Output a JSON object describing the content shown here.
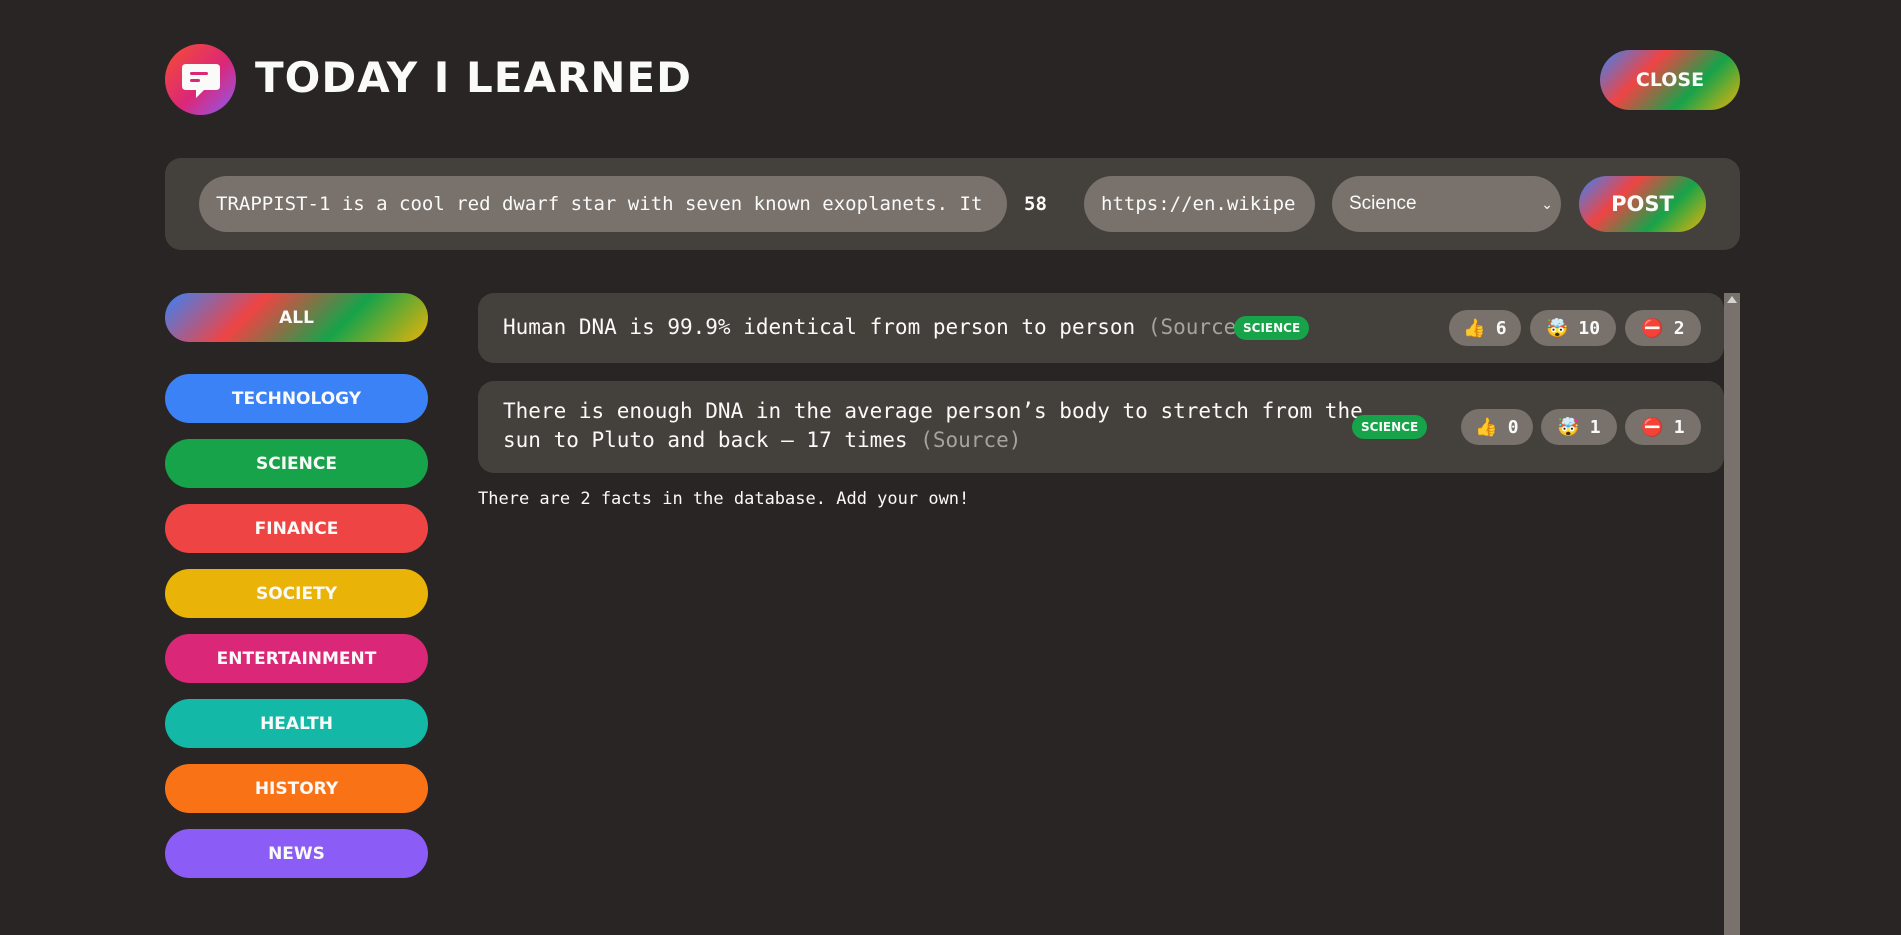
{
  "header": {
    "title": "Today I Learned",
    "logo_icon": "speech-bubble-icon",
    "close_label": "Close"
  },
  "form": {
    "fact_value": "TRAPPIST-1 is a cool red dwarf star with seven known exoplanets. It",
    "char_count": "58",
    "source_value": "https://en.wikipe",
    "category_value": "Science",
    "post_label": "Post"
  },
  "categories": [
    {
      "label": "All",
      "color": "gradient"
    },
    {
      "label": "Technology",
      "color": "#3b82f6"
    },
    {
      "label": "Science",
      "color": "#16a34a"
    },
    {
      "label": "Finance",
      "color": "#ef4444"
    },
    {
      "label": "Society",
      "color": "#eab308"
    },
    {
      "label": "Entertainment",
      "color": "#db2777"
    },
    {
      "label": "Health",
      "color": "#14b8a6"
    },
    {
      "label": "History",
      "color": "#f97316"
    },
    {
      "label": "News",
      "color": "#8b5cf6"
    }
  ],
  "facts": [
    {
      "text": "Human DNA is 99.9% identical from person to person",
      "source_label": "(Source)",
      "category": "Science",
      "category_color": "#16a34a",
      "votes": {
        "like_icon": "👍",
        "like": "6",
        "mindblown_icon": "🤯",
        "mindblown": "10",
        "false_icon": "⛔",
        "false": "2"
      }
    },
    {
      "text_line1": "There is enough DNA in the average person’s body to stretch from the",
      "text_line2": "sun to Pluto and back — 17 times",
      "source_label": "(Source)",
      "category": "Science",
      "category_color": "#16a34a",
      "votes": {
        "like_icon": "👍",
        "like": "0",
        "mindblown_icon": "🤯",
        "mindblown": "1",
        "false_icon": "⛔",
        "false": "1"
      }
    }
  ],
  "footer_message": "There are 2 facts in the database. Add your own!"
}
